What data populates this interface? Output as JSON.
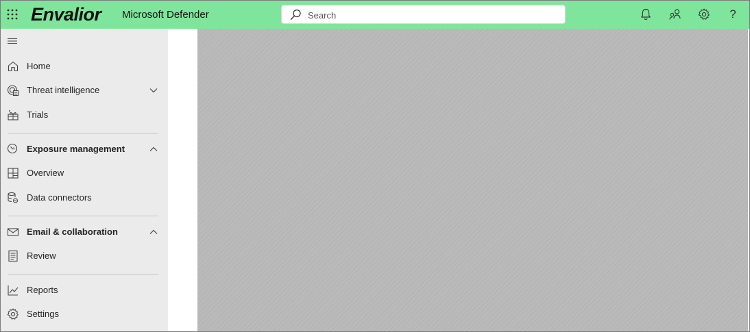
{
  "header": {
    "brand": "Envalior",
    "product": "Microsoft Defender",
    "search_placeholder": "Search",
    "help_glyph": "?",
    "icons": [
      "app-launcher-icon",
      "search-icon",
      "bell-icon",
      "people-share-icon",
      "gear-icon",
      "help-icon"
    ]
  },
  "sidebar": {
    "items": [
      {
        "label": "Home",
        "icon": "home-icon"
      },
      {
        "label": "Threat intelligence",
        "icon": "threat-intel-icon",
        "expanded": false
      },
      {
        "label": "Trials",
        "icon": "trials-icon"
      },
      {
        "label": "Exposure management",
        "icon": "exposure-icon",
        "expanded": true
      },
      {
        "label": "Overview",
        "icon": "overview-icon"
      },
      {
        "label": "Data connectors",
        "icon": "data-connectors-icon"
      },
      {
        "label": "Email & collaboration",
        "icon": "mail-icon",
        "expanded": true
      },
      {
        "label": "Review",
        "icon": "review-icon"
      },
      {
        "label": "Reports",
        "icon": "reports-icon"
      },
      {
        "label": "Settings",
        "icon": "gear-icon"
      }
    ]
  },
  "colors": {
    "header_bg": "#7fe59c",
    "sidebar_bg": "#ebebeb",
    "content_overlay": "#b9b9b9"
  }
}
